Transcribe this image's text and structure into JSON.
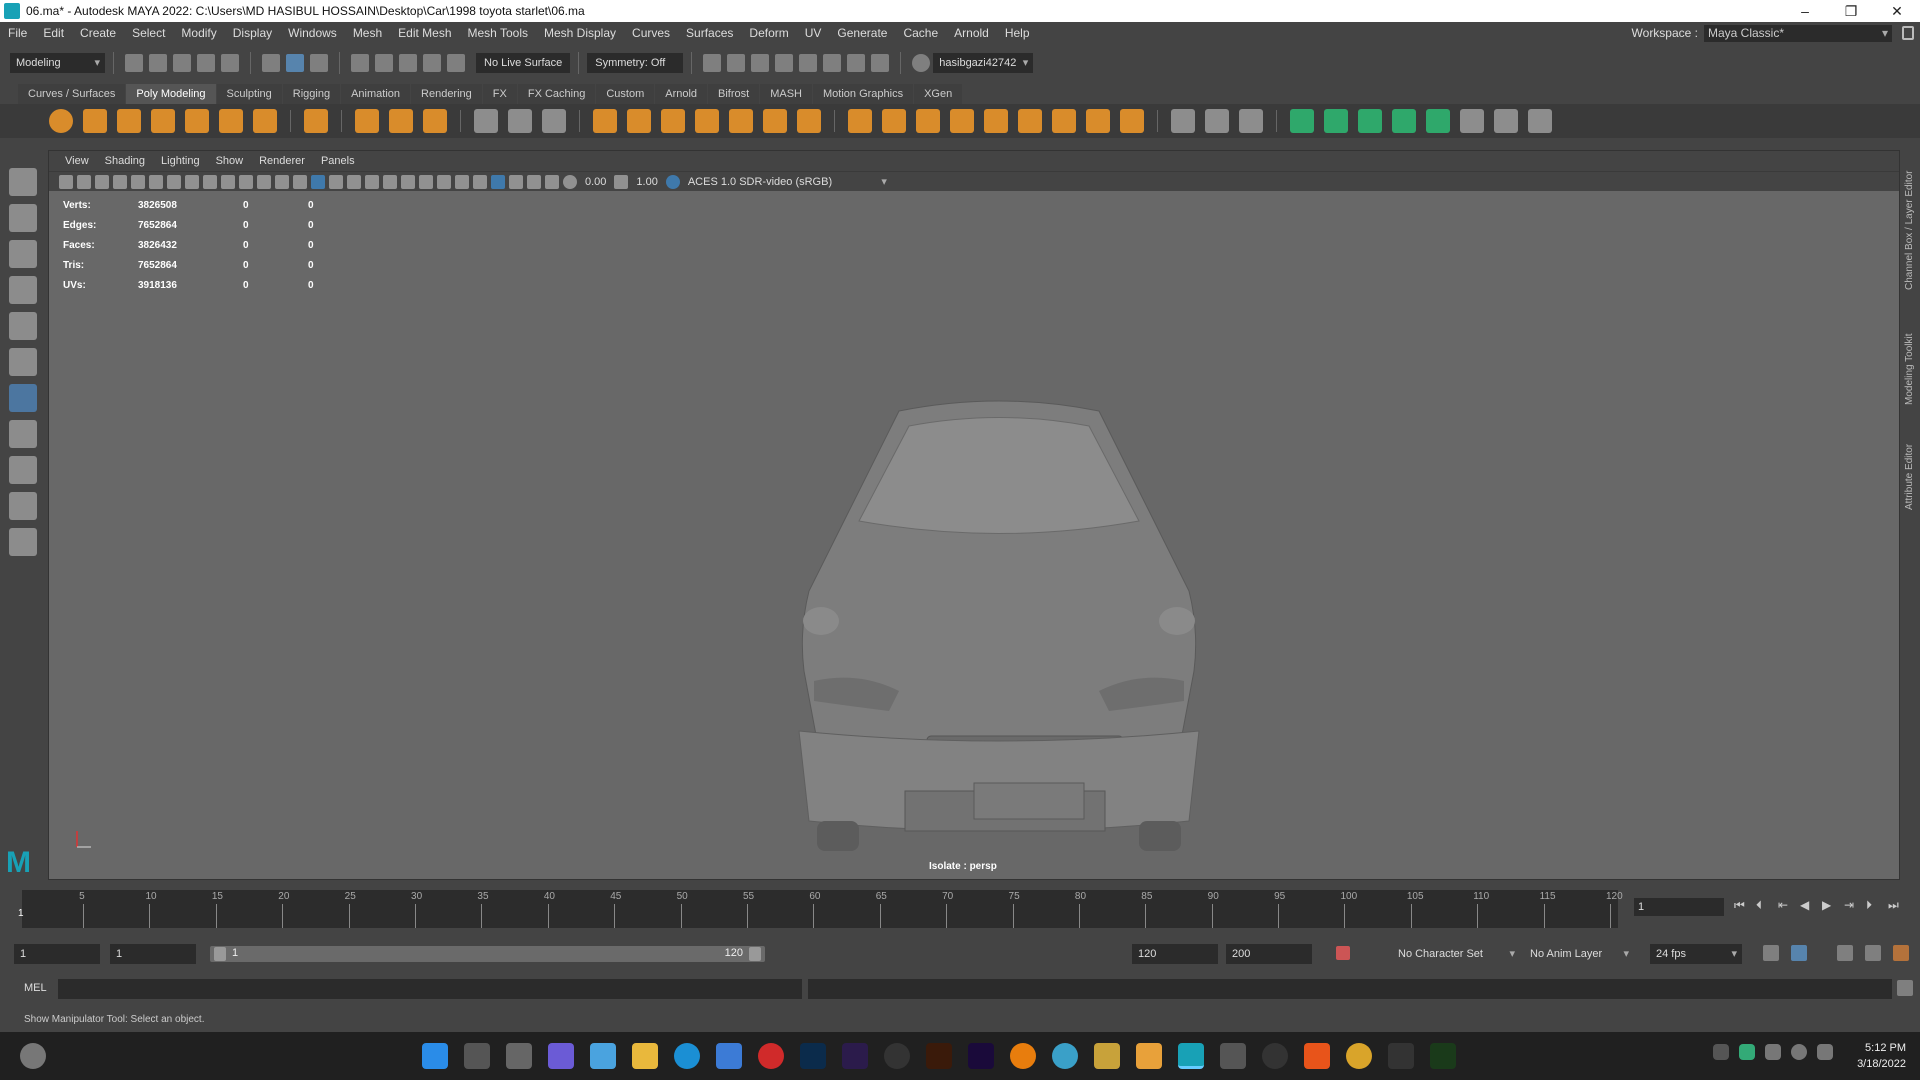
{
  "window": {
    "title": "06.ma* - Autodesk MAYA 2022: C:\\Users\\MD HASIBUL HOSSAIN\\Desktop\\Car\\1998 toyota starlet\\06.ma",
    "controls": [
      "–",
      "❐",
      "✕"
    ]
  },
  "menubar": {
    "items": [
      "File",
      "Edit",
      "Create",
      "Select",
      "Modify",
      "Display",
      "Windows",
      "Mesh",
      "Edit Mesh",
      "Mesh Tools",
      "Mesh Display",
      "Curves",
      "Surfaces",
      "Deform",
      "UV",
      "Generate",
      "Cache",
      "Arnold",
      "Help"
    ],
    "workspace_label": "Workspace :",
    "workspace_value": "Maya Classic*"
  },
  "statusline": {
    "mode": "Modeling",
    "live_surface": "No Live Surface",
    "symmetry": "Symmetry: Off",
    "user": "hasibgazi42742"
  },
  "shelf": {
    "tabs": [
      "Curves / Surfaces",
      "Poly Modeling",
      "Sculpting",
      "Rigging",
      "Animation",
      "Rendering",
      "FX",
      "FX Caching",
      "Custom",
      "Arnold",
      "Bifrost",
      "MASH",
      "Motion Graphics",
      "XGen"
    ],
    "active_tab": "Poly Modeling"
  },
  "panel": {
    "menus": [
      "View",
      "Shading",
      "Lighting",
      "Show",
      "Renderer",
      "Panels"
    ],
    "exposure": "0.00",
    "gamma": "1.00",
    "color_space": "ACES 1.0 SDR-video (sRGB)"
  },
  "hud": {
    "rows": [
      {
        "label": "Verts:",
        "v1": "3826508",
        "v2": "0",
        "v3": "0"
      },
      {
        "label": "Edges:",
        "v1": "7652864",
        "v2": "0",
        "v3": "0"
      },
      {
        "label": "Faces:",
        "v1": "3826432",
        "v2": "0",
        "v3": "0"
      },
      {
        "label": "Tris:",
        "v1": "7652864",
        "v2": "0",
        "v3": "0"
      },
      {
        "label": "UVs:",
        "v1": "3918136",
        "v2": "0",
        "v3": "0"
      }
    ],
    "isolate": "Isolate : persp"
  },
  "side_tabs": [
    "Channel Box / Layer Editor",
    "Modeling Toolkit",
    "Attribute Editor"
  ],
  "timeline": {
    "ticks": [
      "5",
      "10",
      "15",
      "20",
      "25",
      "30",
      "35",
      "40",
      "45",
      "50",
      "55",
      "60",
      "65",
      "70",
      "75",
      "80",
      "85",
      "90",
      "95",
      "100",
      "105",
      "110",
      "115",
      "120"
    ],
    "start_marker": "1",
    "current_frame": "1"
  },
  "range": {
    "start": "1",
    "anim_start": "1",
    "slider_start": "1",
    "slider_end": "120",
    "end": "120",
    "anim_end": "200",
    "char_set": "No Character Set",
    "anim_layer": "No Anim Layer",
    "fps": "24 fps"
  },
  "cmd": {
    "lang": "MEL",
    "help": "Show Manipulator Tool: Select an object."
  },
  "taskbar": {
    "time": "5:12 PM",
    "date": "3/18/2022"
  }
}
